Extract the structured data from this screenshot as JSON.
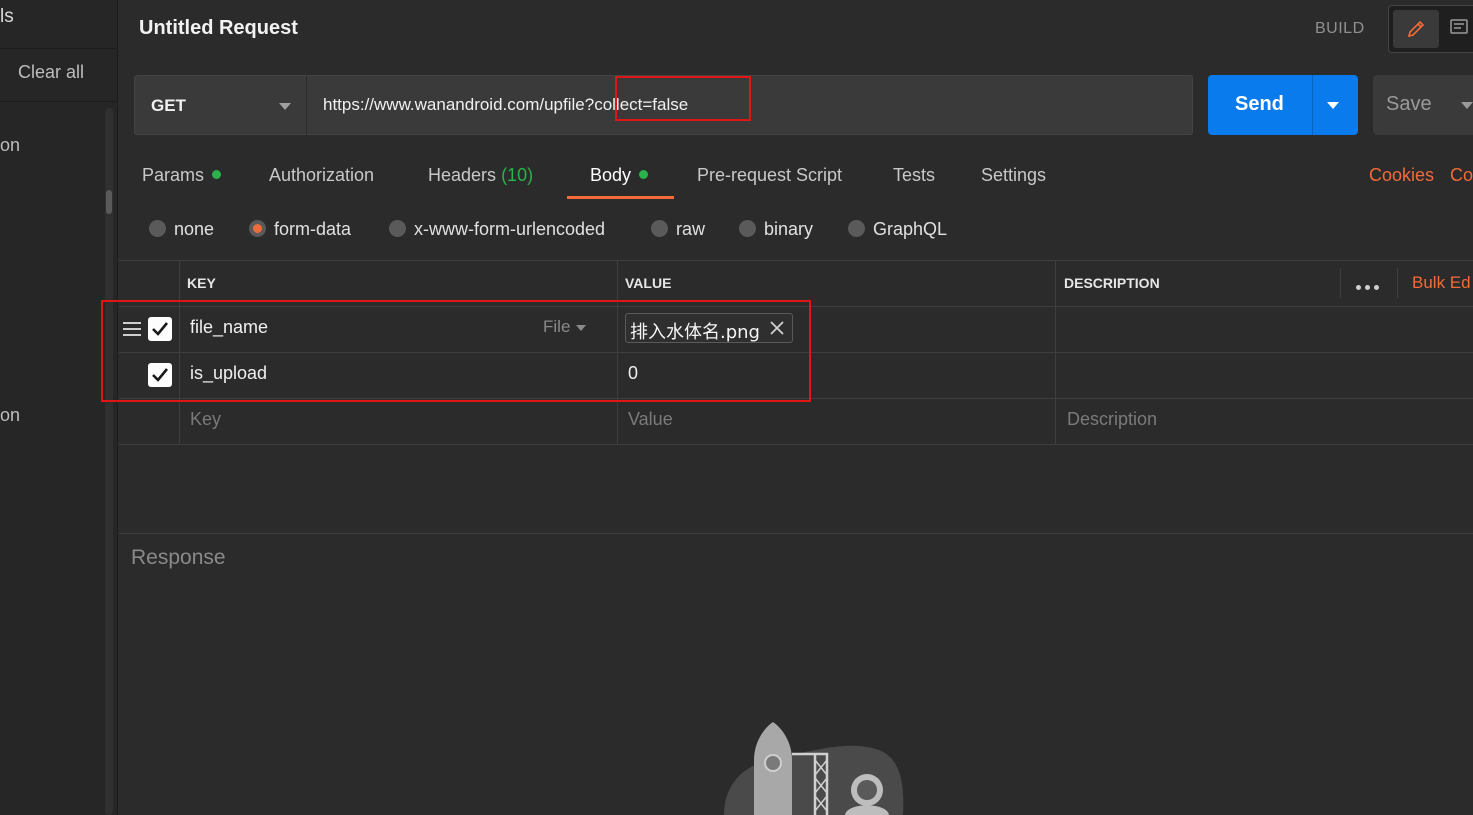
{
  "sidebar": {
    "title_fragment": "ls",
    "clear_all": "Clear all",
    "items": [
      "on",
      "on"
    ]
  },
  "header": {
    "title": "Untitled Request",
    "build_label": "BUILD"
  },
  "request": {
    "method": "GET",
    "url": "https://www.wanandroid.com/upfile?collect=false",
    "send_label": "Send",
    "save_label": "Save"
  },
  "tabs": [
    {
      "label": "Params",
      "dot": true
    },
    {
      "label": "Authorization"
    },
    {
      "label": "Headers",
      "count": "(10)"
    },
    {
      "label": "Body",
      "dot": true,
      "active": true
    },
    {
      "label": "Pre-request Script"
    },
    {
      "label": "Tests"
    },
    {
      "label": "Settings"
    }
  ],
  "links": {
    "cookies": "Cookies",
    "code": "Co"
  },
  "body_types": [
    {
      "label": "none"
    },
    {
      "label": "form-data",
      "selected": true
    },
    {
      "label": "x-www-form-urlencoded"
    },
    {
      "label": "raw"
    },
    {
      "label": "binary"
    },
    {
      "label": "GraphQL"
    }
  ],
  "table": {
    "headers": {
      "key": "KEY",
      "value": "VALUE",
      "description": "DESCRIPTION"
    },
    "bulk_edit": "Bulk Ed",
    "rows": [
      {
        "key": "file_name",
        "type": "File",
        "value": "排入水体名.png",
        "checked": true
      },
      {
        "key": "is_upload",
        "value": "0",
        "checked": true
      }
    ],
    "placeholders": {
      "key": "Key",
      "value": "Value",
      "description": "Description"
    }
  },
  "response": {
    "title": "Response"
  },
  "colors": {
    "accent_orange": "#f26b3a",
    "send_blue": "#097bed",
    "status_green": "#2bb24c",
    "highlight_red": "#e01515"
  }
}
